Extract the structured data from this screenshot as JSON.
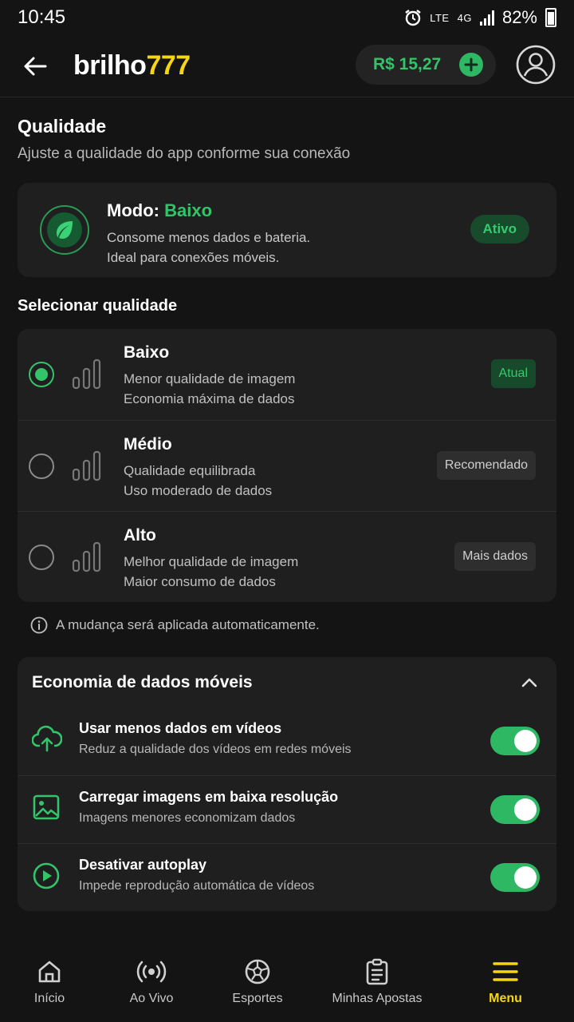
{
  "status_bar": {
    "time": "10:45",
    "network": "LTE",
    "net_type": "4G",
    "battery": "82%"
  },
  "header": {
    "logo_text": "brilho",
    "logo_num": "777",
    "balance": "R$ 15,27"
  },
  "quality": {
    "title": "Qualidade",
    "subtitle": "Ajuste a qualidade do app conforme sua conexão",
    "mode": {
      "label": "Modo: ",
      "value": "Baixo",
      "desc1": "Consome menos dados e bateria.",
      "desc2": "Ideal para conexões móveis.",
      "badge": "Ativo"
    },
    "select_title": "Selecionar qualidade",
    "options": [
      {
        "name": "Baixo",
        "desc1": "Menor qualidade de imagem",
        "desc2": "Economia máxima de dados",
        "badge": "Atual",
        "selected": true
      },
      {
        "name": "Médio",
        "desc1": "Qualidade equilibrada",
        "desc2": "Uso moderado de dados",
        "badge": "Recomendado",
        "selected": false
      },
      {
        "name": "Alto",
        "desc1": "Melhor qualidade de imagem",
        "desc2": "Maior consumo de dados",
        "badge": "Mais dados",
        "selected": false
      }
    ],
    "info": "A mudança será aplicada automaticamente."
  },
  "economy": {
    "title": "Economia de dados móveis",
    "items": [
      {
        "name": "Usar menos dados em vídeos",
        "desc": "Reduz a qualidade dos vídeos em redes móveis",
        "on": true,
        "icon": "cloud-upload-icon"
      },
      {
        "name": "Carregar imagens em baixa resolução",
        "desc": "Imagens menores economizam dados",
        "on": true,
        "icon": "image-icon"
      },
      {
        "name": "Desativar autoplay",
        "desc": "Impede reprodução automática de vídeos",
        "on": true,
        "icon": "play-circle-icon"
      }
    ]
  },
  "nav": [
    {
      "label": "Início",
      "icon": "home-icon"
    },
    {
      "label": "Ao Vivo",
      "icon": "live-icon"
    },
    {
      "label": "Esportes",
      "icon": "ball-icon"
    },
    {
      "label": "Minhas Apostas",
      "icon": "clipboard-icon"
    },
    {
      "label": "Menu",
      "icon": "menu-icon"
    }
  ],
  "colors": {
    "accent_green": "#33c46a",
    "brand_yellow": "#f5d516",
    "background": "#141414",
    "card": "#1f1f1f"
  }
}
